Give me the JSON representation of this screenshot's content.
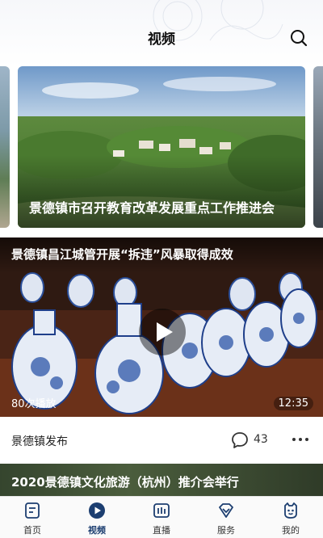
{
  "header": {
    "title": "视频",
    "search_icon": "search-icon"
  },
  "carousel": {
    "slides": [
      {
        "title": "景德镇市召开教育改革发展重点工作推进会"
      }
    ]
  },
  "video": {
    "title": "景德镇昌江城管开展“拆违”风暴取得成效",
    "views": "80次播放",
    "duration": "12:35",
    "source": "景德镇发布",
    "comments": "43",
    "play_icon": "play-icon",
    "more_icon": "more-dots-icon"
  },
  "next_video": {
    "title": "2020景德镇文化旅游（杭州）推介会举行"
  },
  "bottom_nav": {
    "items": [
      {
        "label": "首页",
        "icon": "home-doc-icon"
      },
      {
        "label": "视频",
        "icon": "video-play-icon",
        "active": true
      },
      {
        "label": "直播",
        "icon": "live-bars-icon"
      },
      {
        "label": "服务",
        "icon": "service-gem-icon"
      },
      {
        "label": "我的",
        "icon": "profile-face-icon"
      }
    ]
  },
  "colors": {
    "accent": "#1c3e70",
    "text": "#222222",
    "nav_bg": "#fafafa"
  }
}
